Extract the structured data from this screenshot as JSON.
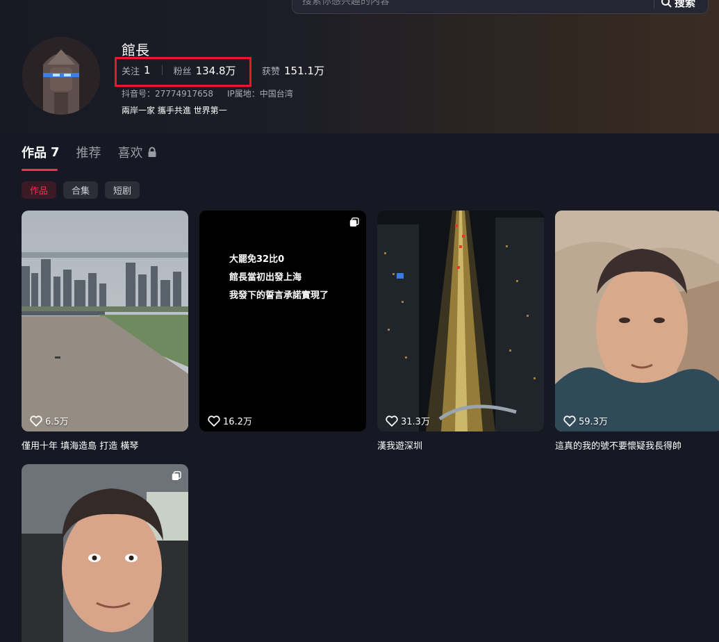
{
  "search": {
    "placeholder": "搜索你感兴趣的内容",
    "button_label": "搜索"
  },
  "profile": {
    "name": "館長",
    "following_label": "关注",
    "following_value": "1",
    "followers_label": "粉丝",
    "followers_value": "134.8万",
    "likes_label": "获赞",
    "likes_value": "151.1万",
    "douyin_id": "抖音号：27774917658",
    "ip_location": "IP属地：中国台湾",
    "bio": "兩岸一家 攜手共進 世界第一"
  },
  "tabs": [
    {
      "label": "作品",
      "count": "7",
      "active": true
    },
    {
      "label": "推荐"
    },
    {
      "label": "喜欢",
      "icon": "lock-icon"
    }
  ],
  "chips": [
    {
      "label": "作品",
      "active": true
    },
    {
      "label": "合集"
    },
    {
      "label": "短剧"
    }
  ],
  "videos": [
    {
      "likes": "6.5万",
      "caption": "僅用十年 填海造島 打造 橫琴"
    },
    {
      "likes": "16.2万",
      "caption": "",
      "overlay_lines": [
        "大罷免32比0",
        "館長當初出發上海",
        "我發下的誓言承諾實現了"
      ],
      "icon": "multi-image-icon"
    },
    {
      "likes": "31.3万",
      "caption": "漢我遊深圳"
    },
    {
      "likes": "59.3万",
      "caption": "這真的我的號不要懷疑我長得帥"
    },
    {
      "likes": "",
      "caption": "",
      "icon": "multi-image-icon"
    }
  ],
  "colors": {
    "accent": "#fe2c55",
    "highlight_box": "#e8192c",
    "background": "#161823"
  }
}
